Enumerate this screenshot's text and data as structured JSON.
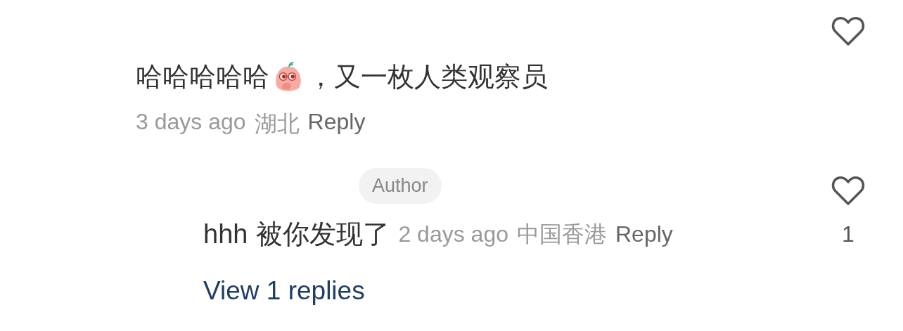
{
  "comment": {
    "text_before": "哈哈哈哈哈",
    "text_after": "，又一枚人类观察员",
    "time": "3 days ago",
    "location": "湖北",
    "reply": "Reply",
    "liked": false
  },
  "reply": {
    "badge": "Author",
    "user": "hhh",
    "text": "被你发现了",
    "time": "2 days ago",
    "location": "中国香港",
    "reply": "Reply",
    "liked": false,
    "like_count": "1"
  },
  "view_replies": "View 1 replies"
}
